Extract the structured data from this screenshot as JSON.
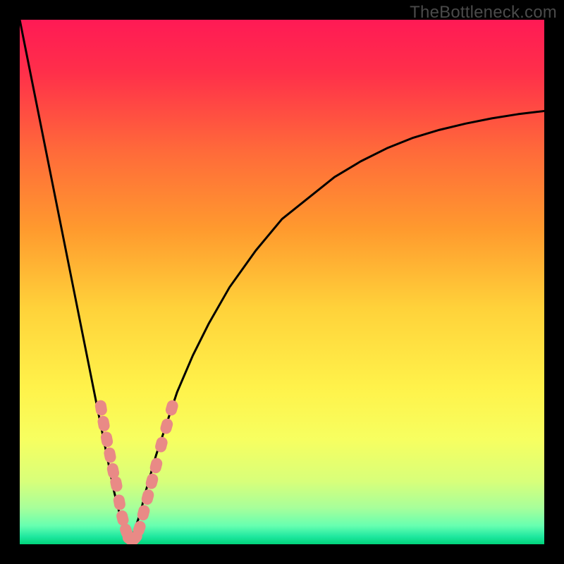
{
  "watermark": "TheBottleneck.com",
  "gradient": {
    "stops": [
      {
        "offset": 0.0,
        "color": "#ff1a55"
      },
      {
        "offset": 0.1,
        "color": "#ff2f4a"
      },
      {
        "offset": 0.25,
        "color": "#ff6a3a"
      },
      {
        "offset": 0.4,
        "color": "#ff9a2e"
      },
      {
        "offset": 0.55,
        "color": "#ffd23a"
      },
      {
        "offset": 0.7,
        "color": "#fff24a"
      },
      {
        "offset": 0.8,
        "color": "#f7ff60"
      },
      {
        "offset": 0.88,
        "color": "#d8ff7a"
      },
      {
        "offset": 0.93,
        "color": "#a8ff9a"
      },
      {
        "offset": 0.965,
        "color": "#66ffb0"
      },
      {
        "offset": 0.985,
        "color": "#20e8a0"
      },
      {
        "offset": 1.0,
        "color": "#00d47a"
      }
    ]
  },
  "chart_data": {
    "type": "line",
    "title": "",
    "xlabel": "",
    "ylabel": "",
    "xlim": [
      0,
      100
    ],
    "ylim": [
      0,
      100
    ],
    "x_min_curve": 21,
    "series": [
      {
        "name": "left-branch",
        "x": [
          0,
          2,
          4,
          6,
          8,
          10,
          12,
          14,
          16,
          17,
          18,
          19,
          20,
          21
        ],
        "y": [
          100,
          90,
          80,
          70,
          60,
          50,
          40,
          30,
          20,
          15,
          10,
          6,
          3,
          0
        ]
      },
      {
        "name": "right-branch",
        "x": [
          21,
          22,
          23,
          24,
          26,
          28,
          30,
          33,
          36,
          40,
          45,
          50,
          55,
          60,
          65,
          70,
          75,
          80,
          85,
          90,
          95,
          100
        ],
        "y": [
          0,
          3,
          6,
          10,
          17,
          23,
          29,
          36,
          42,
          49,
          56,
          62,
          66,
          70,
          73,
          75.5,
          77.5,
          79,
          80.2,
          81.2,
          82,
          82.6
        ]
      }
    ],
    "markers": {
      "name": "highlighted-points",
      "color": "#e98a86",
      "points": [
        {
          "x": 15.5,
          "y": 26
        },
        {
          "x": 16.0,
          "y": 23
        },
        {
          "x": 16.6,
          "y": 20
        },
        {
          "x": 17.2,
          "y": 17
        },
        {
          "x": 17.8,
          "y": 14
        },
        {
          "x": 18.4,
          "y": 11.5
        },
        {
          "x": 19.0,
          "y": 8
        },
        {
          "x": 19.6,
          "y": 5
        },
        {
          "x": 20.3,
          "y": 2.5
        },
        {
          "x": 21.0,
          "y": 1.0
        },
        {
          "x": 22.0,
          "y": 1.2
        },
        {
          "x": 22.8,
          "y": 3
        },
        {
          "x": 23.6,
          "y": 6
        },
        {
          "x": 24.4,
          "y": 9
        },
        {
          "x": 25.2,
          "y": 12
        },
        {
          "x": 26.0,
          "y": 15
        },
        {
          "x": 27.0,
          "y": 19
        },
        {
          "x": 28.0,
          "y": 22.5
        },
        {
          "x": 29.0,
          "y": 26
        }
      ]
    }
  }
}
